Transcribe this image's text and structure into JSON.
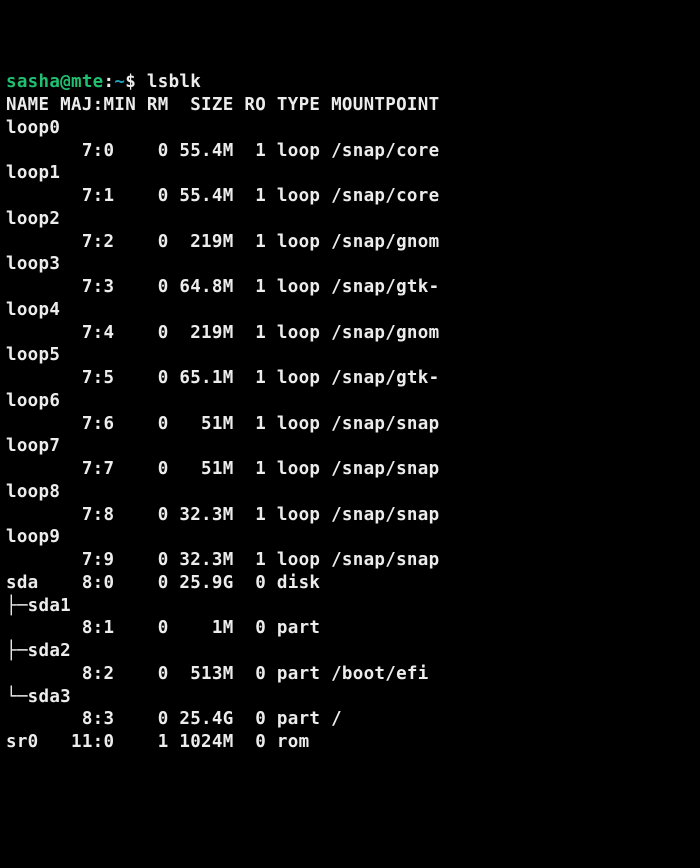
{
  "prompt": {
    "user_host": "sasha@mte",
    "sep": ":",
    "path": "~",
    "symbol": "$",
    "command": "lsblk"
  },
  "header": "NAME MAJ:MIN RM  SIZE RO TYPE MOUNTPOINT",
  "rows": [
    {
      "txt": "loop0"
    },
    {
      "txt": "       7:0    0 55.4M  1 loop /snap/core"
    },
    {
      "txt": "loop1"
    },
    {
      "txt": "       7:1    0 55.4M  1 loop /snap/core"
    },
    {
      "txt": "loop2"
    },
    {
      "txt": "       7:2    0  219M  1 loop /snap/gnom"
    },
    {
      "txt": "loop3"
    },
    {
      "txt": "       7:3    0 64.8M  1 loop /snap/gtk-"
    },
    {
      "txt": "loop4"
    },
    {
      "txt": "       7:4    0  219M  1 loop /snap/gnom"
    },
    {
      "txt": "loop5"
    },
    {
      "txt": "       7:5    0 65.1M  1 loop /snap/gtk-"
    },
    {
      "txt": "loop6"
    },
    {
      "txt": "       7:6    0   51M  1 loop /snap/snap"
    },
    {
      "txt": "loop7"
    },
    {
      "txt": "       7:7    0   51M  1 loop /snap/snap"
    },
    {
      "txt": "loop8"
    },
    {
      "txt": "       7:8    0 32.3M  1 loop /snap/snap"
    },
    {
      "txt": "loop9"
    },
    {
      "txt": "       7:9    0 32.3M  1 loop /snap/snap"
    },
    {
      "txt": "sda    8:0    0 25.9G  0 disk "
    },
    {
      "txt": "├─sda1"
    },
    {
      "txt": "       8:1    0    1M  0 part "
    },
    {
      "txt": "├─sda2"
    },
    {
      "txt": "       8:2    0  513M  0 part /boot/efi"
    },
    {
      "txt": "└─sda3"
    },
    {
      "txt": "       8:3    0 25.4G  0 part /"
    },
    {
      "txt": "sr0   11:0    1 1024M  0 rom  "
    }
  ]
}
